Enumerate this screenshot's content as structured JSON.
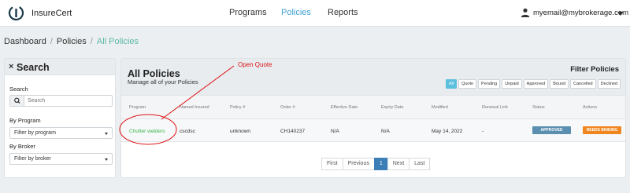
{
  "nav": {
    "brand": "InsureCert",
    "links": [
      "Programs",
      "Policies",
      "Reports"
    ],
    "user_email": "myemail@mybrokerage.com",
    "active_color": "#3f9fd0"
  },
  "breadcrumb": [
    "Dashboard",
    "Policies",
    "All Policies"
  ],
  "search_panel": {
    "title": "Search",
    "search_label": "Search",
    "search_placeholder": "Search",
    "program_label": "By Program",
    "program_value": "Filter by program",
    "broker_label": "By Broker",
    "broker_value": "Filter by broker"
  },
  "policies": {
    "title": "All Policies",
    "subtitle": "Manage all of your Policies",
    "filter_title": "Filter Policies",
    "filters": [
      "All",
      "Quote",
      "Pending",
      "Unpaid",
      "Approved",
      "Bound",
      "Cancelled",
      "Declined"
    ],
    "active_filter": "All",
    "columns": [
      "Program",
      "Named Insured",
      "Policy #",
      "Order #",
      "Effective Date",
      "Expiry Date",
      "Modified",
      "Renewal Link",
      "Status",
      "Actions"
    ],
    "rows": [
      {
        "program": "Chutter welders",
        "named_insured": "cscdsc",
        "policy_no": "unknown",
        "order_no": "CH140237",
        "effective": "N/A",
        "expiry": "N/A",
        "modified": "May 14, 2022",
        "renewal": "-",
        "status": "APPROVED",
        "action": "NEEDS BINDING"
      }
    ],
    "pagination": [
      "First",
      "Previous",
      "1",
      "Next",
      "Last"
    ],
    "current_page": "1"
  },
  "annotation": {
    "label": "Open Quote",
    "color": "#dd1111"
  },
  "colors": {
    "status_approved": "#5a8fb0",
    "action_needs_binding": "#f0861f",
    "program_link": "#39b54a",
    "breadcrumb_current": "#5cb7a8"
  }
}
